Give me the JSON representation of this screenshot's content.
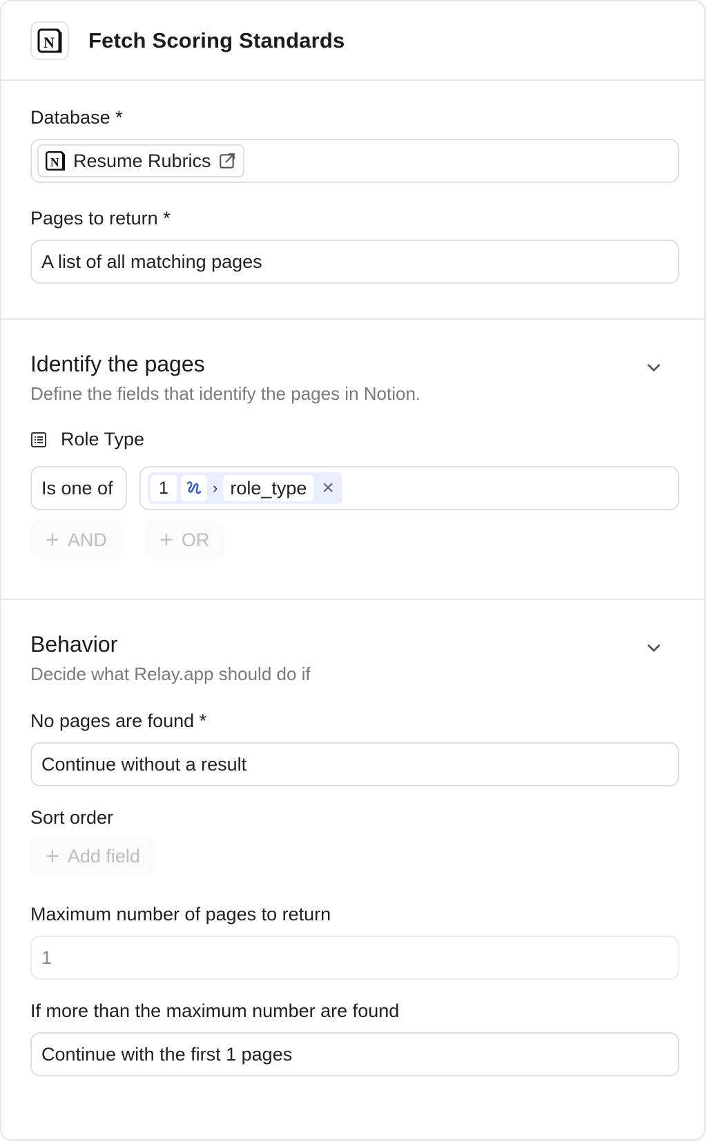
{
  "header": {
    "title": "Fetch Scoring Standards",
    "app_icon": "notion-icon"
  },
  "database": {
    "label": "Database *",
    "value": "Resume Rubrics"
  },
  "pages_to_return": {
    "label": "Pages to return *",
    "value": "A list of all matching pages"
  },
  "identify": {
    "title": "Identify the pages",
    "subtitle": "Define the fields that identify the pages in Notion.",
    "property": {
      "label": "Role Type",
      "operator": "Is one of",
      "token_step": "1",
      "token_separator": "›",
      "token_value": "role_type",
      "token_remove": "×"
    },
    "and_label": "AND",
    "or_label": "OR"
  },
  "behavior": {
    "title": "Behavior",
    "subtitle": "Decide what Relay.app should do if",
    "no_pages": {
      "label": "No pages are found *",
      "value": "Continue without a result"
    },
    "sort_order": {
      "label": "Sort order",
      "add_label": "Add field"
    },
    "max_pages": {
      "label": "Maximum number of pages to return",
      "placeholder": "1"
    },
    "over_max": {
      "label": "If more than the maximum number are found",
      "value": "Continue with the first 1 pages"
    }
  },
  "colors": {
    "accent": "#3b5bdb",
    "token_bg": "#e8eeff",
    "border": "#dedede",
    "muted_text": "#7a7a7a"
  }
}
